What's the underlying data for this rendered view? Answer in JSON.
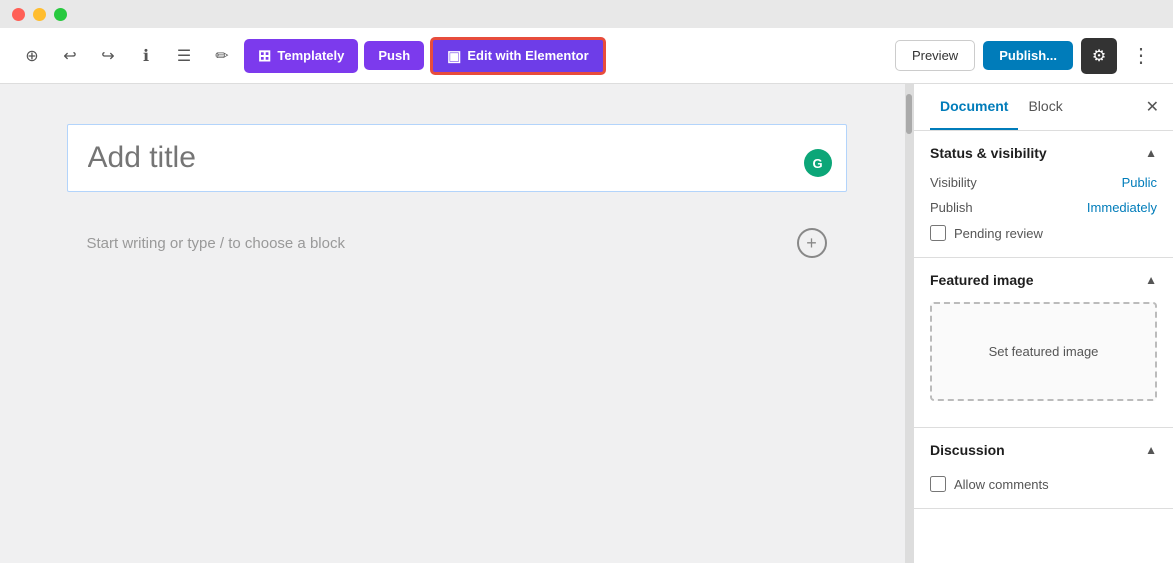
{
  "titleBar": {
    "trafficLights": [
      "red",
      "yellow",
      "green"
    ]
  },
  "toolbar": {
    "addLabel": "+",
    "undoLabel": "↩",
    "redoLabel": "↪",
    "infoLabel": "ℹ",
    "listLabel": "☰",
    "penLabel": "✏",
    "templatlyLabel": "Templately",
    "pushLabel": "Push",
    "elementorLabel": "Edit with Elementor",
    "previewLabel": "Preview",
    "publishLabel": "Publish...",
    "settingsLabel": "⚙",
    "moreLabel": "⋮"
  },
  "editor": {
    "titlePlaceholder": "Add title",
    "contentPlaceholder": "Start writing or type / to choose a block",
    "grammarlyInitial": "G"
  },
  "sidebar": {
    "tabs": [
      {
        "label": "Document",
        "active": true
      },
      {
        "label": "Block",
        "active": false
      }
    ],
    "sections": [
      {
        "id": "status-visibility",
        "title": "Status & visibility",
        "expanded": true,
        "rows": [
          {
            "label": "Visibility",
            "value": "Public"
          },
          {
            "label": "Publish",
            "value": "Immediately"
          }
        ],
        "checkboxes": [
          {
            "label": "Pending review",
            "checked": false
          }
        ]
      },
      {
        "id": "featured-image",
        "title": "Featured image",
        "expanded": true,
        "setImageLabel": "Set featured image"
      },
      {
        "id": "discussion",
        "title": "Discussion",
        "expanded": true,
        "checkboxes": [
          {
            "label": "Allow comments",
            "checked": false
          }
        ]
      }
    ]
  }
}
